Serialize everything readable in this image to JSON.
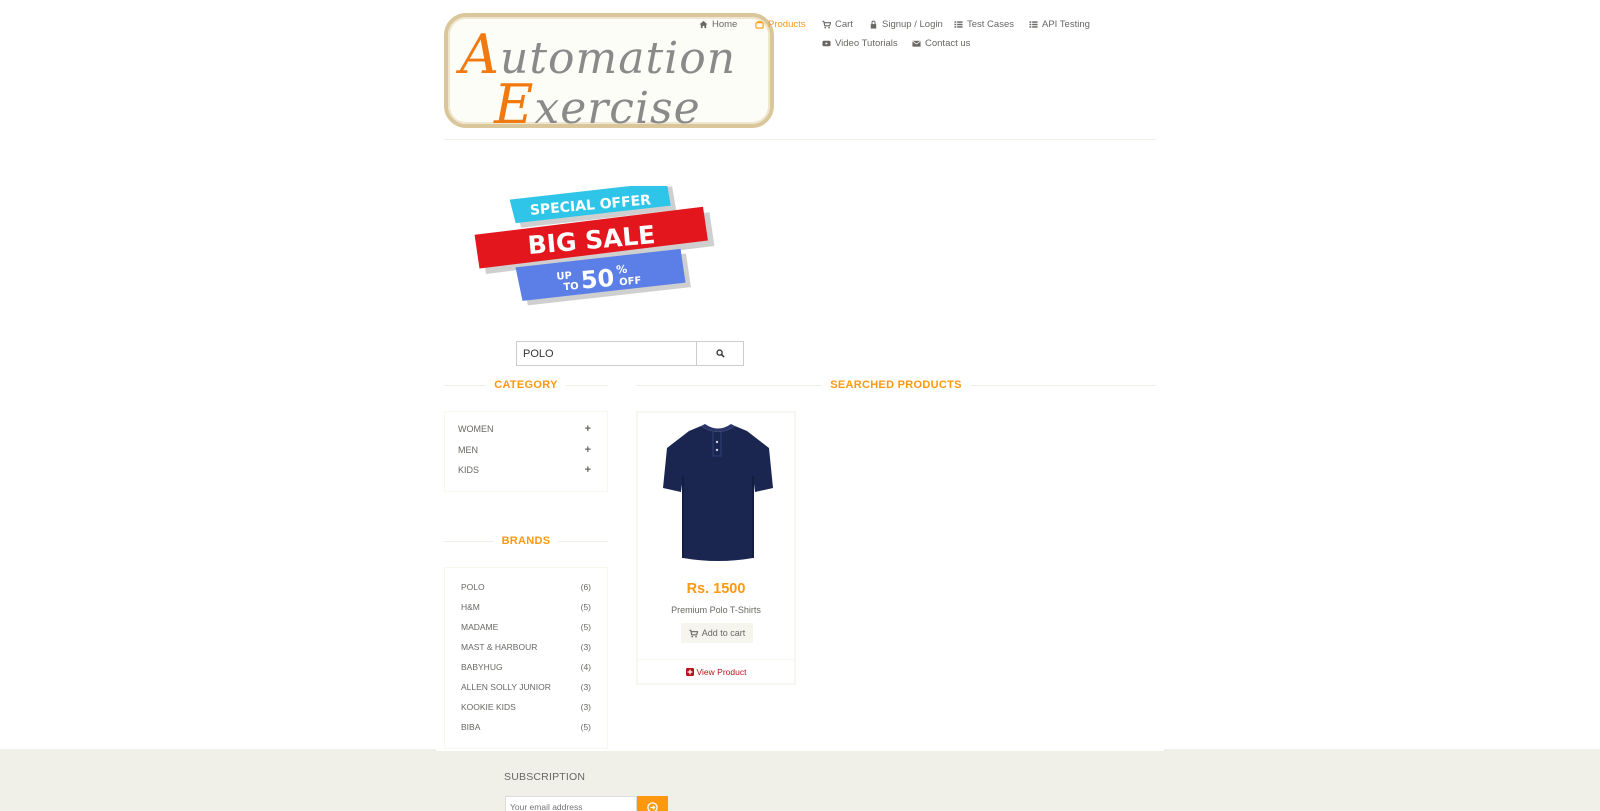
{
  "header": {
    "logo_line1_cap": "A",
    "logo_line1_rest": "utomation",
    "logo_line2_cap": "E",
    "logo_line2_rest": "xercise",
    "nav": {
      "home": "Home",
      "products": "Products",
      "cart": "Cart",
      "signup": "Signup / Login",
      "test_cases": "Test Cases",
      "api_testing": "API Testing",
      "video_tutorials": "Video Tutorials",
      "contact_us": "Contact us"
    }
  },
  "banner": {
    "line1": "SPECIAL OFFER",
    "line2": "BIG SALE",
    "line3_a": "UP",
    "line3_b": "TO",
    "line3_num": "50",
    "line3_pct": "%",
    "line3_off": "OFF"
  },
  "search": {
    "value": "POLO"
  },
  "sidebar": {
    "category_title": "CATEGORY",
    "categories": [
      "WOMEN",
      "MEN",
      "KIDS"
    ],
    "brands_title": "BRANDS",
    "brands": [
      {
        "name": "POLO",
        "count": "(6)"
      },
      {
        "name": "H&M",
        "count": "(5)"
      },
      {
        "name": "MADAME",
        "count": "(5)"
      },
      {
        "name": "MAST & HARBOUR",
        "count": "(3)"
      },
      {
        "name": "BABYHUG",
        "count": "(4)"
      },
      {
        "name": "ALLEN SOLLY JUNIOR",
        "count": "(3)"
      },
      {
        "name": "KOOKIE KIDS",
        "count": "(3)"
      },
      {
        "name": "BIBA",
        "count": "(5)"
      }
    ]
  },
  "main": {
    "title": "SEARCHED PRODUCTS",
    "products": [
      {
        "price": "Rs. 1500",
        "name": "Premium Polo T-Shirts",
        "add_to_cart": "Add to cart",
        "view_product": "View Product"
      }
    ]
  },
  "footer": {
    "subscription_title": "SUBSCRIPTION",
    "email_placeholder": "Your email address"
  },
  "colors": {
    "accent": "#fe980f",
    "text": "#696763",
    "footer_bg": "#f0f0e9",
    "view_product": "#b4151b"
  }
}
